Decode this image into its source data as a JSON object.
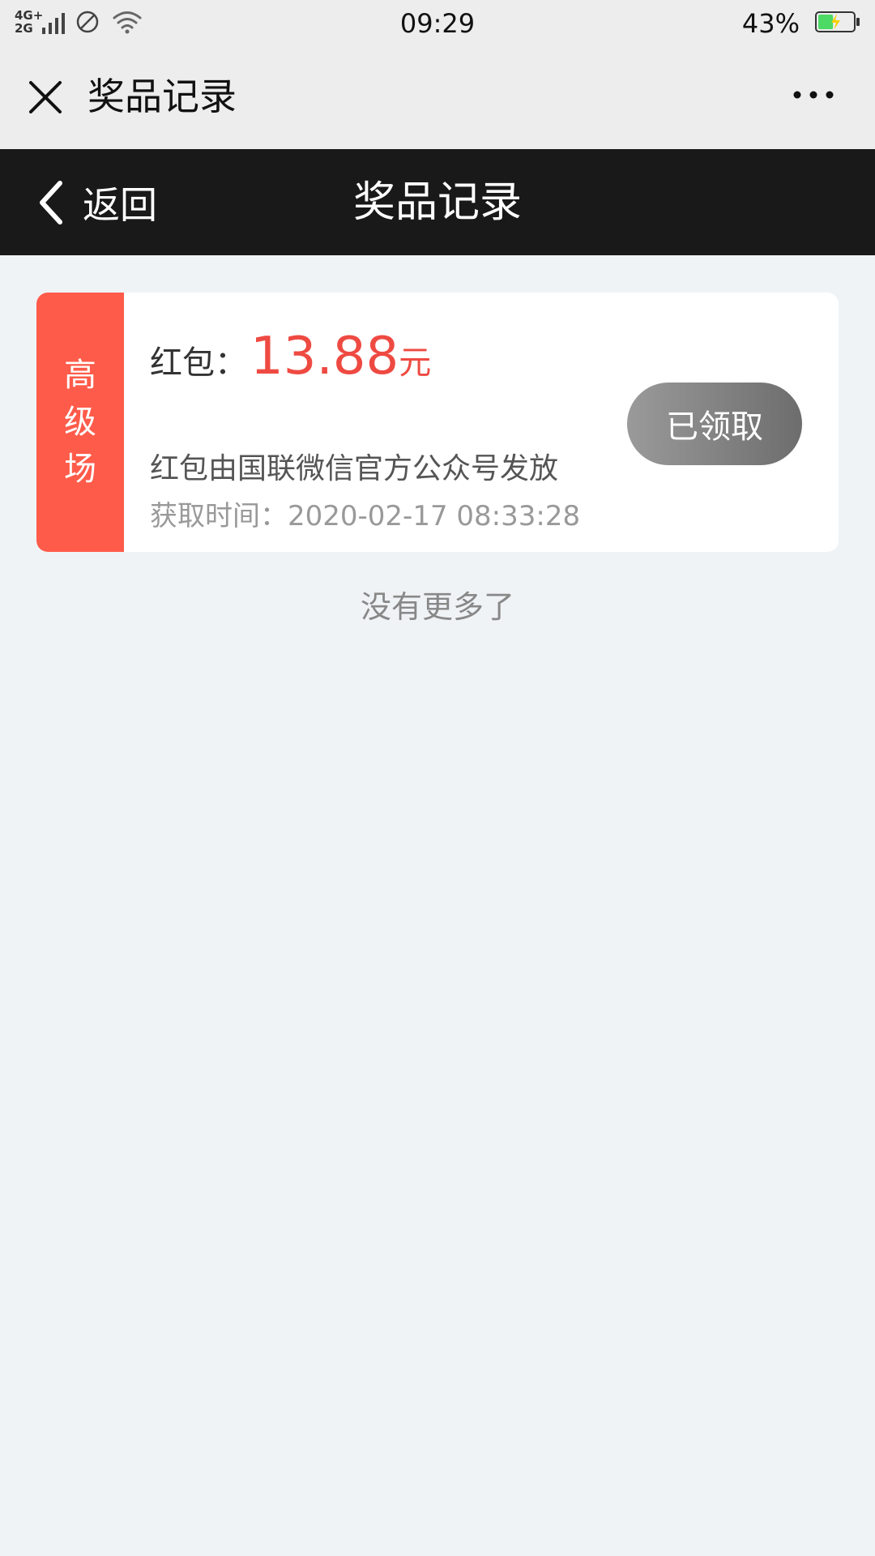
{
  "status_bar": {
    "network_top": "4G+",
    "network_bottom": "2G",
    "time": "09:29",
    "battery_percent": "43%",
    "battery_level": 0.43,
    "icons": [
      "signal-icon",
      "do-not-disturb-icon",
      "wifi-icon",
      "battery-charging-icon"
    ]
  },
  "wechat_header": {
    "title": "奖品记录",
    "close_icon": "close-icon",
    "more_icon": "more-dots-icon"
  },
  "page_nav": {
    "back_label": "返回",
    "title": "奖品记录"
  },
  "prize_records": [
    {
      "tag_chars": [
        "高",
        "级",
        "场"
      ],
      "prize_label": "红包：",
      "amount": "13.88",
      "unit": "元",
      "issuer": "红包由国联微信官方公众号发放",
      "time_label": "获取时间：",
      "time_value": "2020-02-17 08:33:28",
      "status_button": "已领取"
    }
  ],
  "footer": {
    "no_more": "没有更多了"
  },
  "colors": {
    "tag_bg": "#ff5b4a",
    "amount": "#ee4a42",
    "nav_bg": "#1a191a",
    "page_bg": "#f0f3f6",
    "battery_fill": "#4cd964"
  }
}
